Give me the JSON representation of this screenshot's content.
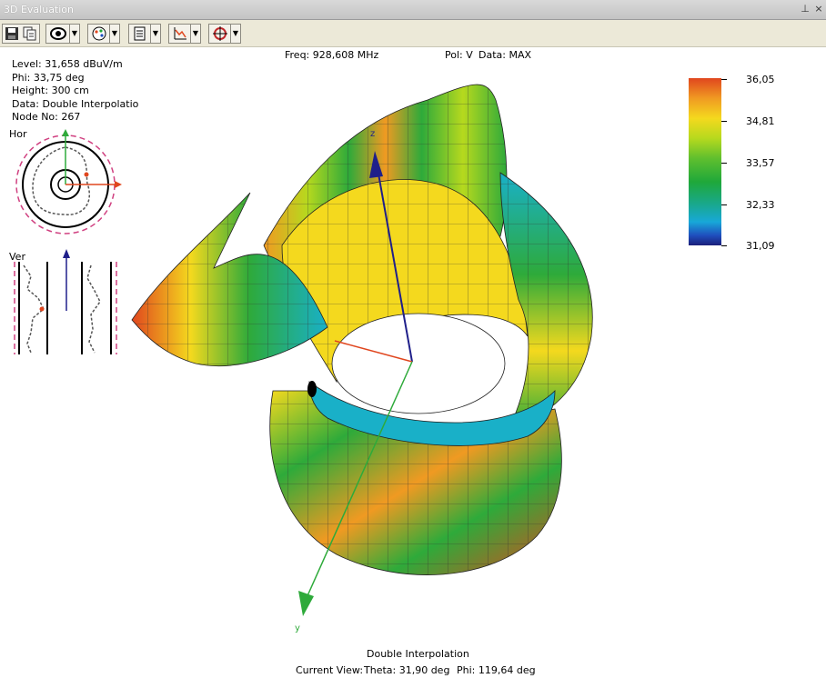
{
  "window": {
    "title": "3D Evaluation",
    "pin_glyph": "⊥",
    "close_glyph": "×"
  },
  "toolbar": {
    "buttons": [
      "save-icon",
      "copy-icon",
      "eye-view-icon",
      "palette-icon",
      "document-icon",
      "chart-axes-icon",
      "target-icon"
    ]
  },
  "info": {
    "level": "Level: 31,658 dBuV/m",
    "phi": "Phi: 33,75 deg",
    "height": "Height: 300 cm",
    "data": "Data: Double Interpolatio",
    "node": "Node No: 267"
  },
  "header": {
    "freq": "Freq: 928,608 MHz",
    "pol": "Pol: V",
    "data": "Data: MAX"
  },
  "mini": {
    "hor_label": "Hor",
    "ver_label": "Ver"
  },
  "axes": {
    "z": "z",
    "y": "y"
  },
  "legend": {
    "labels": [
      "36,05",
      "34,81",
      "33,57",
      "32,33",
      "31,09"
    ]
  },
  "bottom": {
    "mode": "Double Interpolation",
    "current_view": "Current View:",
    "theta": "Theta: 31,90 deg",
    "phi": "Phi: 119,64 deg"
  },
  "colors": {
    "red": "#e0461e",
    "orange": "#f09a22",
    "yellow": "#f4d91e",
    "lime": "#b6d91e",
    "green": "#2eaa3a",
    "cyan": "#19b0c8",
    "blue": "#1f4fbe"
  }
}
